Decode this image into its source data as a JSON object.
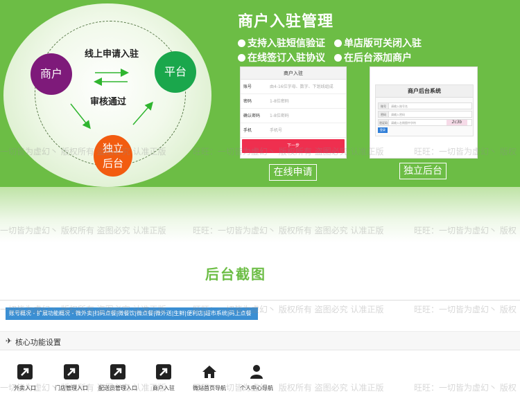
{
  "banner": {
    "title": "商户入驻管理",
    "features": [
      "支持入驻短信验证",
      "单店版可关闭入驻",
      "在线签订入驻协议",
      "在后台添加商户"
    ]
  },
  "flow": {
    "merchant": "商户",
    "platform": "平台",
    "independent_line1": "独立",
    "independent_line2": "后台",
    "apply_label": "线上申请入驻",
    "approve_label": "审核通过"
  },
  "signup_form": {
    "header": "商户入驻",
    "fields": [
      {
        "label": "账号",
        "placeholder": "由4-16位字母、数字、下划线组成"
      },
      {
        "label": "密码",
        "placeholder": "1-8位密码"
      },
      {
        "label": "确认密码",
        "placeholder": "1-8位密码"
      },
      {
        "label": "手机",
        "placeholder": "手机号"
      }
    ],
    "submit": "下一步"
  },
  "backend_login": {
    "title": "商户后台系统",
    "account_label": "账号",
    "account_placeholder": "请输入账号名",
    "password_label": "密码",
    "password_placeholder": "请输入密码",
    "captcha_label": "验证码",
    "captcha_placeholder": "请输入右侧图中字符",
    "captcha_text": "2c3b",
    "login": "登录"
  },
  "captions": {
    "online_apply": "在线申请",
    "independent_backend": "独立后台"
  },
  "screenshot_section": {
    "title": "后台截图",
    "nav_text": "账号概况 - 扩展功能概况 - 微外卖|扫码点餐|微餐饮|微点餐|微外送|生鲜|便利店|超市系统|码上点餐",
    "settings_title": "核心功能设置",
    "tools": [
      {
        "label": "外卖入口",
        "icon": "arrow-icon"
      },
      {
        "label": "门店管理入口",
        "icon": "arrow-icon"
      },
      {
        "label": "配送员管理入口",
        "icon": "arrow-icon"
      },
      {
        "label": "商户入驻",
        "icon": "arrow-icon"
      },
      {
        "label": "微站首页导航",
        "icon": "home-icon"
      },
      {
        "label": "个人中心导航",
        "icon": "user-icon"
      }
    ]
  },
  "watermarks": {
    "a": "一切皆为虚幻丶 版权所有 盗图必究 认准正版",
    "b": "旺旺：一切皆为虚幻丶 版权所有 盗图必究 认准正版",
    "c": "旺旺：一切皆为虚幻丶 版权"
  },
  "colors": {
    "banner_green": "#6cbd45",
    "merchant": "#7e1a7a",
    "platform": "#1aa74c",
    "independent": "#f25c10",
    "nav_blue": "#3b8fd3",
    "submit_red": "#ef2f4f"
  }
}
